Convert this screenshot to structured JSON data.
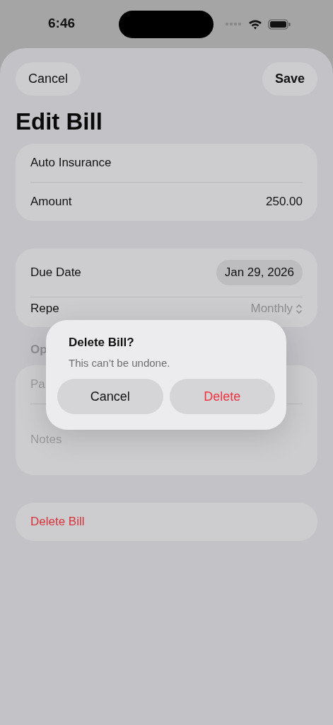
{
  "status_bar": {
    "time": "6:46"
  },
  "nav": {
    "cancel": "Cancel",
    "save": "Save"
  },
  "title": "Edit Bill",
  "bill": {
    "name": "Auto Insurance",
    "amount_label": "Amount",
    "amount": "250.00"
  },
  "schedule": {
    "due_label": "Due Date",
    "due_value": "Jan 29, 2026",
    "repeat_label": "Repe",
    "repeat_value": "Monthly"
  },
  "optional": {
    "header": "Op",
    "payee_placeholder": "Pa",
    "notes_placeholder": "Notes"
  },
  "delete_button": "Delete Bill",
  "alert": {
    "title": "Delete Bill?",
    "message": "This can’t be undone.",
    "buttons": [
      {
        "label": "Cancel",
        "kind": "cancel"
      },
      {
        "label": "Delete",
        "kind": "destructive"
      }
    ]
  }
}
